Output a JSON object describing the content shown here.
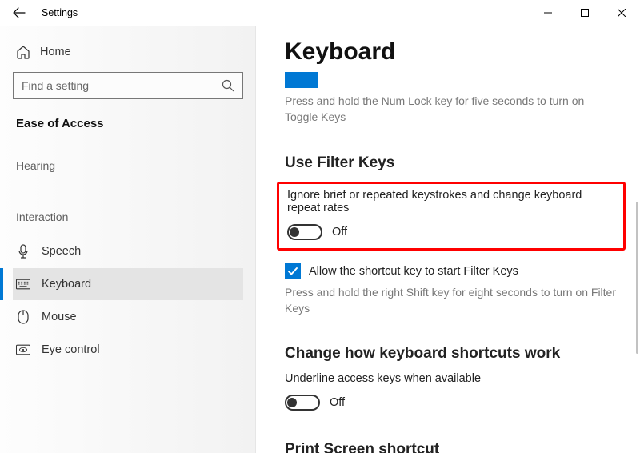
{
  "titlebar": {
    "title": "Settings"
  },
  "sidebar": {
    "home": "Home",
    "search_placeholder": "Find a setting",
    "category": "Ease of Access",
    "groups": [
      "Hearing",
      "Interaction"
    ],
    "items": [
      {
        "label": "Speech"
      },
      {
        "label": "Keyboard"
      },
      {
        "label": "Mouse"
      },
      {
        "label": "Eye control"
      }
    ]
  },
  "content": {
    "page_title": "Keyboard",
    "toggle_keys_desc": "Press and hold the Num Lock key for five seconds to turn on Toggle Keys",
    "sections": [
      {
        "title": "Use Filter Keys",
        "desc": "Ignore brief or repeated keystrokes and change keyboard repeat rates",
        "toggle_state": "Off",
        "checkbox_label": "Allow the shortcut key to start Filter Keys",
        "hint": "Press and hold the right Shift key for eight seconds to turn on Filter Keys"
      },
      {
        "title": "Change how keyboard shortcuts work",
        "desc": "Underline access keys when available",
        "toggle_state": "Off"
      },
      {
        "title": "Print Screen shortcut"
      }
    ]
  }
}
